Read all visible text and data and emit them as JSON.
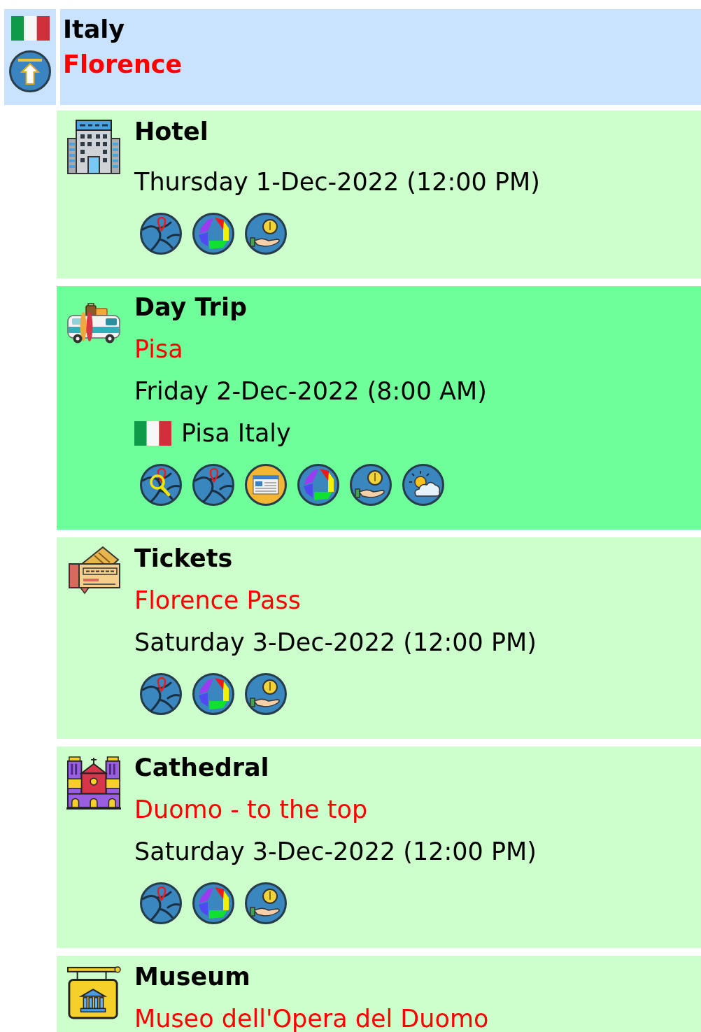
{
  "header": {
    "country": "Italy",
    "city": "Florence"
  },
  "cards": [
    {
      "kind": "hotel",
      "selected": false,
      "title": "Hotel",
      "date": "Thursday 1-Dec-2022 (12:00 PM)",
      "links": [
        {
          "kind": "map"
        },
        {
          "kind": "photos"
        },
        {
          "kind": "money"
        }
      ]
    },
    {
      "kind": "van",
      "selected": true,
      "title": "Day Trip",
      "subtitle": "Pisa",
      "date": "Friday 2-Dec-2022 (8:00 AM)",
      "location": "Pisa Italy",
      "links": [
        {
          "kind": "search_map"
        },
        {
          "kind": "map"
        },
        {
          "kind": "news"
        },
        {
          "kind": "photos"
        },
        {
          "kind": "money"
        },
        {
          "kind": "weather"
        }
      ]
    },
    {
      "kind": "ticket",
      "selected": false,
      "title": "Tickets",
      "subtitle": "Florence Pass",
      "date": "Saturday 3-Dec-2022 (12:00 PM)",
      "links": [
        {
          "kind": "map"
        },
        {
          "kind": "photos"
        },
        {
          "kind": "money"
        }
      ]
    },
    {
      "kind": "cathedral",
      "selected": false,
      "title": "Cathedral",
      "subtitle": "Duomo - to the top",
      "date": "Saturday 3-Dec-2022 (12:00 PM)",
      "links": [
        {
          "kind": "map"
        },
        {
          "kind": "photos"
        },
        {
          "kind": "money"
        }
      ]
    },
    {
      "kind": "museum",
      "selected": false,
      "title": "Museum",
      "subtitle": "Museo dell'Opera del Duomo"
    }
  ]
}
